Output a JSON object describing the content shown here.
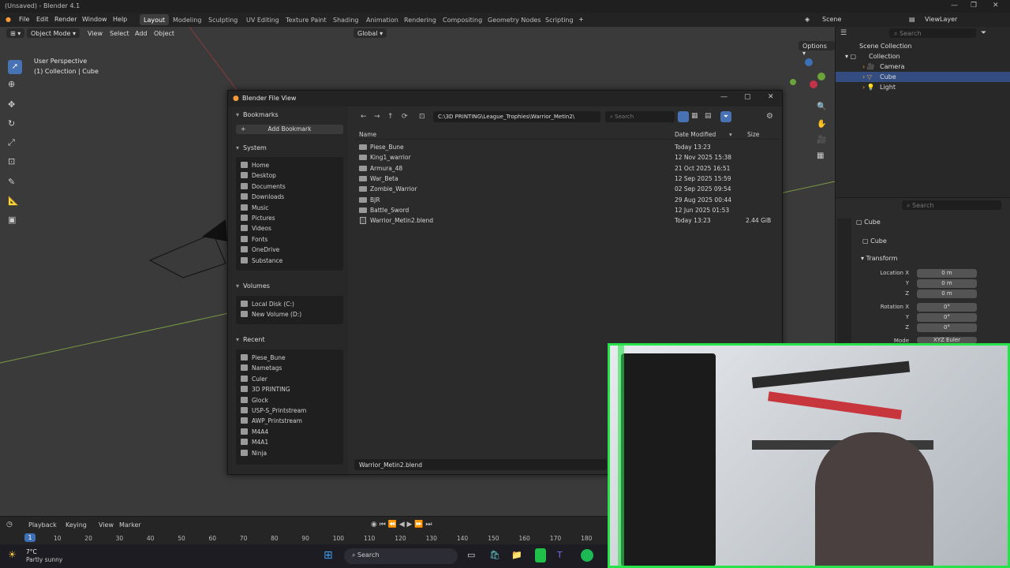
{
  "window": {
    "title": "(Unsaved) - Blender 4.1"
  },
  "menu": [
    "File",
    "Edit",
    "Render",
    "Window",
    "Help"
  ],
  "workspaces": [
    "Layout",
    "Modeling",
    "Sculpting",
    "UV Editing",
    "Texture Paint",
    "Shading",
    "Animation",
    "Rendering",
    "Compositing",
    "Geometry Nodes",
    "Scripting"
  ],
  "scene": {
    "name": "Scene",
    "view_layer": "ViewLayer"
  },
  "viewport": {
    "mode": "Object Mode",
    "menus": [
      "View",
      "Select",
      "Add",
      "Object"
    ],
    "transform": "Global",
    "options": "Options",
    "overlay_title": "User Perspective",
    "overlay_sub": "(1) Collection | Cube"
  },
  "outliner": {
    "search_placeholder": "Search",
    "items": [
      "Scene Collection",
      "Collection",
      "Camera",
      "Cube",
      "Light"
    ]
  },
  "properties": {
    "search_placeholder": "Search",
    "object": "Cube",
    "data": "Cube",
    "panel": "Transform",
    "location": {
      "label_x": "Location X",
      "y": "Y",
      "z": "Z",
      "vx": "0 m",
      "vy": "0 m",
      "vz": "0 m"
    },
    "rotation": {
      "label_x": "Rotation X",
      "y": "Y",
      "z": "Z",
      "vx": "0°",
      "vy": "0°",
      "vz": "0°"
    },
    "mode_label": "Mode",
    "mode_value": "XYZ Euler"
  },
  "dialog": {
    "title": "Blender File View",
    "path": "C:\\3D PRINTING\\League_Trophies\\Warrior_Metin2\\",
    "search_placeholder": "Search",
    "bookmarks_header": "Bookmarks",
    "add_bookmark": "Add Bookmark",
    "system_header": "System",
    "system": [
      "Home",
      "Desktop",
      "Documents",
      "Downloads",
      "Music",
      "Pictures",
      "Videos",
      "Fonts",
      "OneDrive",
      "Substance"
    ],
    "volumes_header": "Volumes",
    "volumes": [
      "Local Disk (C:)",
      "New Volume (D:)"
    ],
    "recent_header": "Recent",
    "recent": [
      "Piese_Bune",
      "Nametags",
      "Culer",
      "3D PRINTING",
      "Glock",
      "USP-S_Printstream",
      "AWP_Printstream",
      "M4A4",
      "M4A1",
      "Ninja"
    ],
    "columns": {
      "name": "Name",
      "date": "Date Modified",
      "size": "Size"
    },
    "files": [
      {
        "name": "Piese_Bune",
        "date": "Today 13:23",
        "size": "",
        "type": "folder"
      },
      {
        "name": "King1_warrior",
        "date": "12 Nov 2025 15:38",
        "size": "",
        "type": "folder"
      },
      {
        "name": "Armura_48",
        "date": "21 Oct 2025 16:51",
        "size": "",
        "type": "folder"
      },
      {
        "name": "War_Beta",
        "date": "12 Sep 2025 15:59",
        "size": "",
        "type": "folder"
      },
      {
        "name": "Zombie_Warrior",
        "date": "02 Sep 2025 09:54",
        "size": "",
        "type": "folder"
      },
      {
        "name": "BJR",
        "date": "29 Aug 2025 00:44",
        "size": "",
        "type": "folder"
      },
      {
        "name": "Battle_Sword",
        "date": "12 Jun 2025 01:53",
        "size": "",
        "type": "folder"
      },
      {
        "name": "Warrior_Metin2.blend",
        "date": "Today 13:23",
        "size": "2.44 GiB",
        "type": "blend"
      }
    ],
    "filename_value": "Warrior_Metin2.blend"
  },
  "timeline": {
    "menus": [
      "Playback",
      "Keying",
      "View",
      "Marker"
    ],
    "current_frame": "1",
    "ticks": [
      "10",
      "20",
      "30",
      "40",
      "50",
      "60",
      "70",
      "80",
      "90",
      "100",
      "110",
      "120",
      "130",
      "140",
      "150",
      "160",
      "170",
      "180"
    ]
  },
  "taskbar": {
    "weather_temp": "7°C",
    "weather_desc": "Partly sunny",
    "search_placeholder": "Search"
  },
  "colors": {
    "accent": "#3d6fb6",
    "selection": "#334d80",
    "webcam_border": "#27e34a"
  }
}
